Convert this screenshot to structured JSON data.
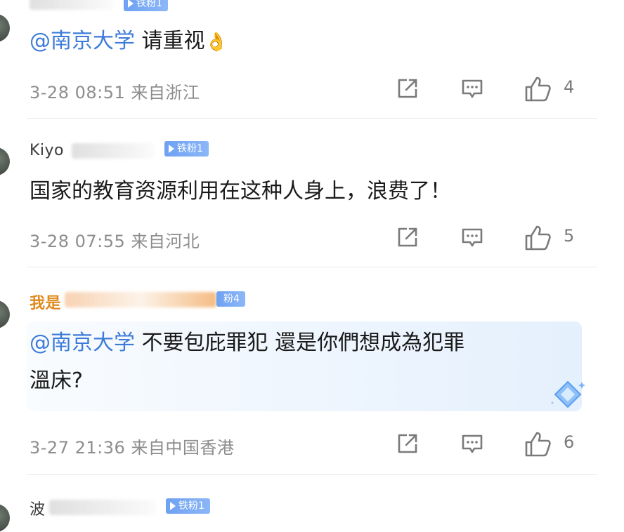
{
  "comments": [
    {
      "username": "",
      "badge": "铁粉1",
      "mention": "@南京大学",
      "text": " 请重视",
      "emoji": "👌",
      "date": "3-28 08:51",
      "location": "来自浙江",
      "likes": "4"
    },
    {
      "username": "Kiyo",
      "badge": "铁粉1",
      "text": "国家的教育资源利用在这种人身上，浪费了！",
      "date": "3-28 07:55",
      "location": "来自河北",
      "likes": "5"
    },
    {
      "username": "我是",
      "badge": "粉4",
      "mention": "@南京大学",
      "text_line1": " 不要包庇罪犯 還是你們想成為犯罪",
      "text_line2": "溫床?",
      "date": "3-27 21:36",
      "location": "来自中国香港",
      "likes": "6"
    },
    {
      "username": "波",
      "badge": "铁粉1"
    }
  ],
  "icons": {
    "share": "share-icon",
    "comment": "comment-icon",
    "like": "thumbs-up-icon",
    "diamond": "diamond-sparkle-icon"
  },
  "colors": {
    "mention": "#3d7bd8",
    "badge": "#6ea1f3",
    "username_orange": "#e08a1e",
    "meta": "#8d8d8d"
  }
}
